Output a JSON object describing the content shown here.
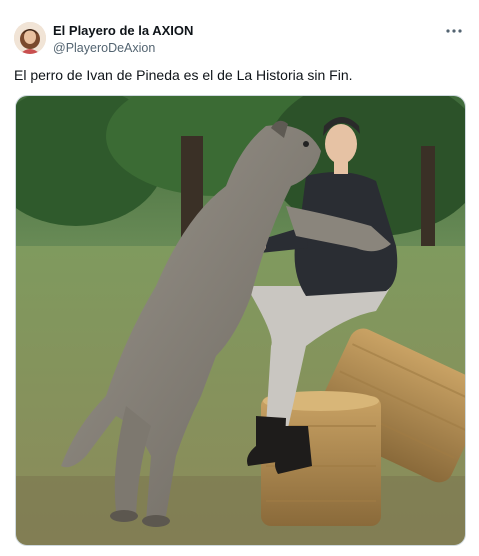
{
  "post": {
    "author": {
      "display_name": "El Playero de la AXION",
      "handle": "@PlayeroDeAxion",
      "avatar_icon": "user-avatar"
    },
    "more_icon": "more-dots-icon",
    "text": "El perro de Ivan de Pineda es el de La Historia sin Fin.",
    "media": {
      "type": "photo",
      "description_icon": "photo-dog-man-hay-bales"
    }
  },
  "colors": {
    "text_primary": "#0f1419",
    "text_secondary": "#536471",
    "border": "#cfd9de"
  }
}
